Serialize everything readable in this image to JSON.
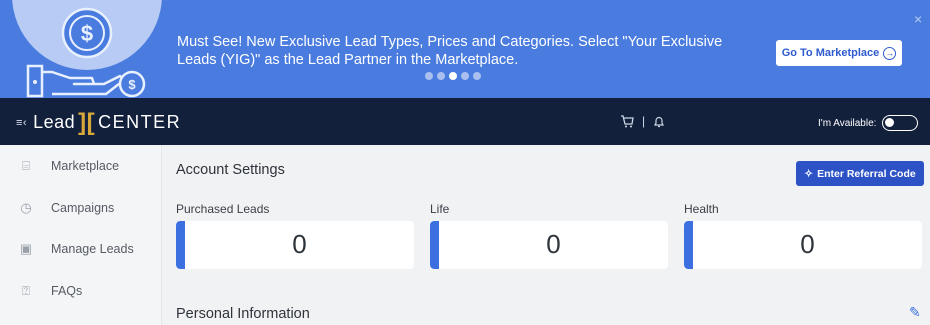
{
  "banner": {
    "message": "Must See! New Exclusive Lead Types, Prices and Categories. Select \"Your Exclusive Leads (YIG)\" as the Lead Partner in the Marketplace.",
    "cta_label": "Go To Marketplace",
    "cta_icon": "arrow-right-circle-icon",
    "close_icon": "close-icon",
    "carousel_dots": 5,
    "active_dot": 3,
    "colors": {
      "background": "#4a7ce0",
      "art": "#c9d8f6"
    }
  },
  "header": {
    "logo": {
      "left": "Lead",
      "right": "CENTER"
    },
    "menu_icon": "collapse-menu-icon",
    "cart_icon": "cart-icon",
    "separator": "|",
    "bell_icon": "bell-icon",
    "availability_label": "I'm Available:",
    "availability_on": false,
    "colors": {
      "background": "#12203c",
      "logo_accent": "#d7a93b"
    }
  },
  "sidebar": {
    "items": [
      {
        "label": "Marketplace",
        "icon": "storefront-icon"
      },
      {
        "label": "Campaigns",
        "icon": "clock-icon"
      },
      {
        "label": "Manage Leads",
        "icon": "contact-card-icon"
      },
      {
        "label": "FAQs",
        "icon": "question-clipboard-icon"
      }
    ]
  },
  "main": {
    "title": "Account Settings",
    "referral_button": "Enter Referral Code",
    "referral_icon": "sparkle-icon",
    "stats": [
      {
        "label": "Purchased Leads",
        "value": "0"
      },
      {
        "label": "Life",
        "value": "0"
      },
      {
        "label": "Health",
        "value": "0"
      }
    ],
    "section_title": "Personal Information",
    "edit_icon": "edit-icon",
    "colors": {
      "accent": "#3c6fe0",
      "button": "#2c52c6"
    }
  }
}
